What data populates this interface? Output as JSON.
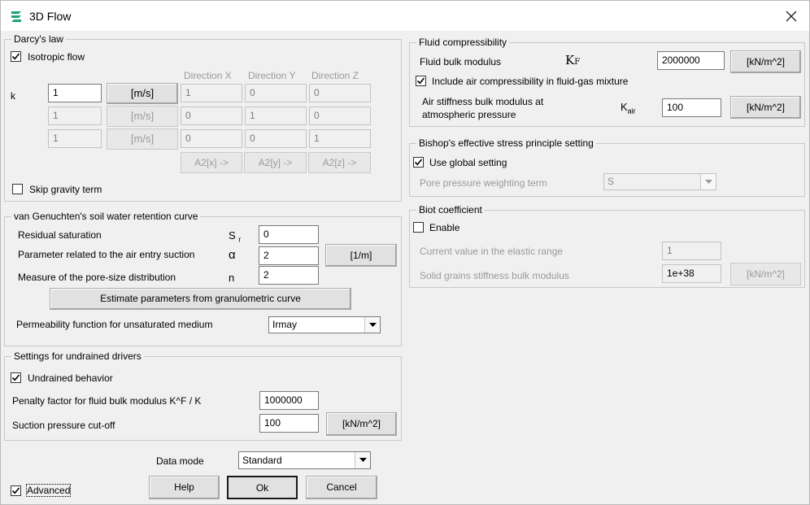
{
  "window": {
    "title": "3D Flow",
    "icon": "app-logo-icon",
    "close_icon": "close-icon"
  },
  "darcy": {
    "title": "Darcy's law",
    "isotropic_label": "Isotropic flow",
    "isotropic_checked": true,
    "k_label": "k",
    "dir_x": "Direction X",
    "dir_y": "Direction Y",
    "dir_z": "Direction Z",
    "rows": [
      {
        "k": "1",
        "unit": "[m/s]",
        "x": "1",
        "y": "0",
        "z": "0"
      },
      {
        "k": "1",
        "unit": "[m/s]",
        "x": "0",
        "y": "1",
        "z": "0"
      },
      {
        "k": "1",
        "unit": "[m/s]",
        "x": "0",
        "y": "0",
        "z": "1"
      }
    ],
    "a2x": "A2[x] ->",
    "a2y": "A2[y] ->",
    "a2z": "A2[z] ->",
    "skip_gravity_label": "Skip gravity term",
    "skip_gravity_checked": false
  },
  "vg": {
    "title": "van Genuchten's soil water retention curve",
    "residual_label": "Residual saturation",
    "residual_symbol": "S",
    "residual_sub": "r",
    "residual_value": "0",
    "air_entry_label": "Parameter related to the air entry suction",
    "air_entry_symbol": "α",
    "air_entry_value": "2",
    "air_entry_unit": "[1/m]",
    "pore_label": "Measure of the pore-size distribution",
    "pore_symbol": "n",
    "pore_value": "2",
    "estimate_button": "Estimate parameters from granulometric curve",
    "perm_label": "Permeability function for unsaturated medium",
    "perm_value": "Irmay"
  },
  "undrained": {
    "title": "Settings for undrained drivers",
    "behavior_label": "Undrained behavior",
    "behavior_checked": true,
    "penalty_label": "Penalty factor for fluid bulk modulus K^F / K",
    "penalty_value": "1000000",
    "suction_label": "Suction pressure cut-off",
    "suction_value": "100",
    "suction_unit": "[kN/m^2]"
  },
  "fluid": {
    "title": "Fluid compressibility",
    "bulk_label": "Fluid bulk modulus",
    "bulk_symbol": "K",
    "bulk_sub": "F",
    "bulk_value": "2000000",
    "bulk_unit": "[kN/m^2]",
    "include_air_label": "Include air compressibility in fluid-gas mixture",
    "include_air_checked": true,
    "air_line1": "Air stiffness bulk modulus at",
    "air_line2": "atmospheric pressure",
    "air_symbol": "K",
    "air_sub": "air",
    "air_value": "100",
    "air_unit": "[kN/m^2]"
  },
  "bishop": {
    "title": "Bishop's effective stress principle setting",
    "global_label": "Use global setting",
    "global_checked": true,
    "weight_label": "Pore pressure weighting term",
    "weight_value": "S"
  },
  "biot": {
    "title": "Biot coefficient",
    "enable_label": "Enable",
    "enable_checked": false,
    "current_label": "Current value in the elastic range",
    "current_value": "1",
    "solid_label": "Solid grains stiffness bulk modulus",
    "solid_value": "1e+38",
    "solid_unit": "[kN/m^2]"
  },
  "footer": {
    "data_mode_label": "Data mode",
    "data_mode_value": "Standard",
    "advanced_label": "Advanced",
    "advanced_checked": true,
    "help": "Help",
    "ok": "Ok",
    "cancel": "Cancel"
  }
}
